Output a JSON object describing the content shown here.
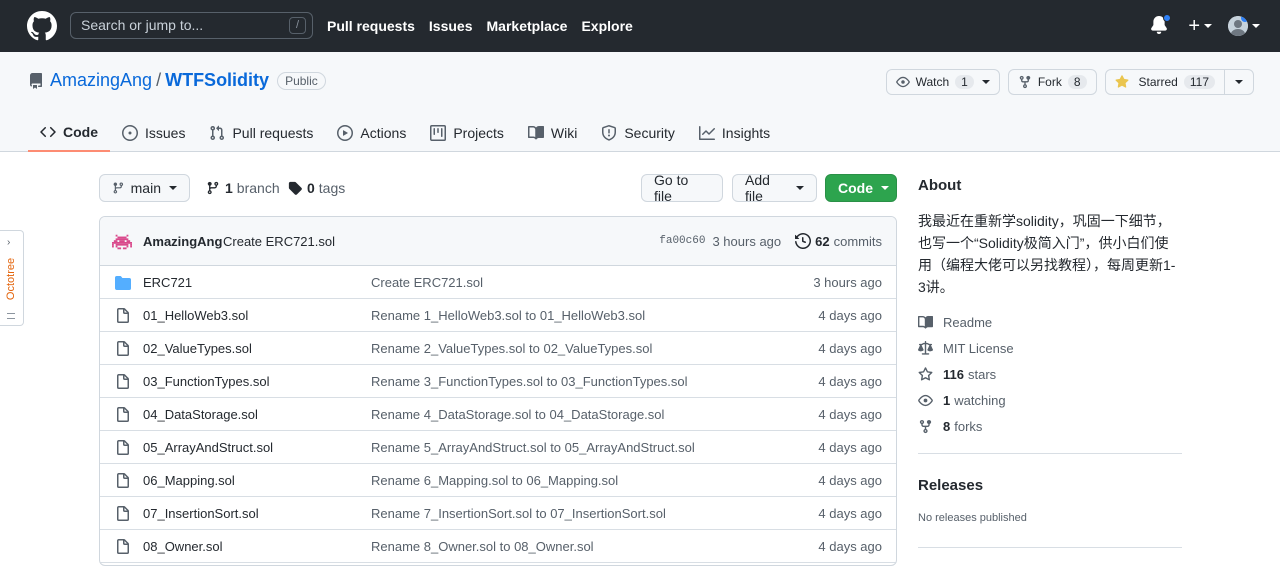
{
  "header": {
    "search_placeholder": "Search or jump to...",
    "search_key": "/",
    "nav": [
      "Pull requests",
      "Issues",
      "Marketplace",
      "Explore"
    ],
    "plus": "+"
  },
  "repo": {
    "owner": "AmazingAng",
    "slash": "/",
    "name": "WTFSolidity",
    "visibility": "Public",
    "watch": {
      "label": "Watch",
      "count": "1"
    },
    "fork": {
      "label": "Fork",
      "count": "8"
    },
    "star": {
      "label": "Starred",
      "count": "117"
    }
  },
  "tabs": [
    {
      "label": "Code",
      "icon": "code-icon",
      "active": true
    },
    {
      "label": "Issues",
      "icon": "issue-icon"
    },
    {
      "label": "Pull requests",
      "icon": "pull-request-icon"
    },
    {
      "label": "Actions",
      "icon": "play-icon"
    },
    {
      "label": "Projects",
      "icon": "project-icon"
    },
    {
      "label": "Wiki",
      "icon": "book-icon"
    },
    {
      "label": "Security",
      "icon": "shield-icon"
    },
    {
      "label": "Insights",
      "icon": "graph-icon"
    }
  ],
  "toolbar": {
    "branch": "main",
    "branch_count": "1",
    "branch_label": "branch",
    "tag_count": "0",
    "tag_label": "tags",
    "go_to_file": "Go to file",
    "add_file": "Add file",
    "code": "Code"
  },
  "commit": {
    "author": "AmazingAng",
    "message": "Create ERC721.sol",
    "hash": "fa00c60",
    "time": "3 hours ago",
    "count": "62",
    "count_label": "commits"
  },
  "files": [
    {
      "type": "dir",
      "name": "ERC721",
      "message": "Create ERC721.sol",
      "age": "3 hours ago"
    },
    {
      "type": "file",
      "name": "01_HelloWeb3.sol",
      "message": "Rename 1_HelloWeb3.sol to 01_HelloWeb3.sol",
      "age": "4 days ago"
    },
    {
      "type": "file",
      "name": "02_ValueTypes.sol",
      "message": "Rename 2_ValueTypes.sol to 02_ValueTypes.sol",
      "age": "4 days ago"
    },
    {
      "type": "file",
      "name": "03_FunctionTypes.sol",
      "message": "Rename 3_FunctionTypes.sol to 03_FunctionTypes.sol",
      "age": "4 days ago"
    },
    {
      "type": "file",
      "name": "04_DataStorage.sol",
      "message": "Rename 4_DataStorage.sol to 04_DataStorage.sol",
      "age": "4 days ago"
    },
    {
      "type": "file",
      "name": "05_ArrayAndStruct.sol",
      "message": "Rename 5_ArrayAndStruct.sol to 05_ArrayAndStruct.sol",
      "age": "4 days ago"
    },
    {
      "type": "file",
      "name": "06_Mapping.sol",
      "message": "Rename 6_Mapping.sol to 06_Mapping.sol",
      "age": "4 days ago"
    },
    {
      "type": "file",
      "name": "07_InsertionSort.sol",
      "message": "Rename 7_InsertionSort.sol to 07_InsertionSort.sol",
      "age": "4 days ago"
    },
    {
      "type": "file",
      "name": "08_Owner.sol",
      "message": "Rename 8_Owner.sol to 08_Owner.sol",
      "age": "4 days ago"
    }
  ],
  "about": {
    "title": "About",
    "description": "我最近在重新学solidity，巩固一下细节，也写一个“Solidity极简入门”，供小白们使用（编程大佬可以另找教程），每周更新1-3讲。",
    "readme": "Readme",
    "license": "MIT License",
    "stars_count": "116",
    "stars_label": "stars",
    "watching_count": "1",
    "watching_label": "watching",
    "forks_count": "8",
    "forks_label": "forks"
  },
  "releases": {
    "title": "Releases",
    "empty": "No releases published"
  },
  "octotree": {
    "label": "Octotree",
    "chevron": "›"
  },
  "colors": {
    "header": "#24292f",
    "link": "#0969da",
    "green": "#2da44e",
    "active_tab": "#fd8c73",
    "folder": "#54aeff"
  }
}
